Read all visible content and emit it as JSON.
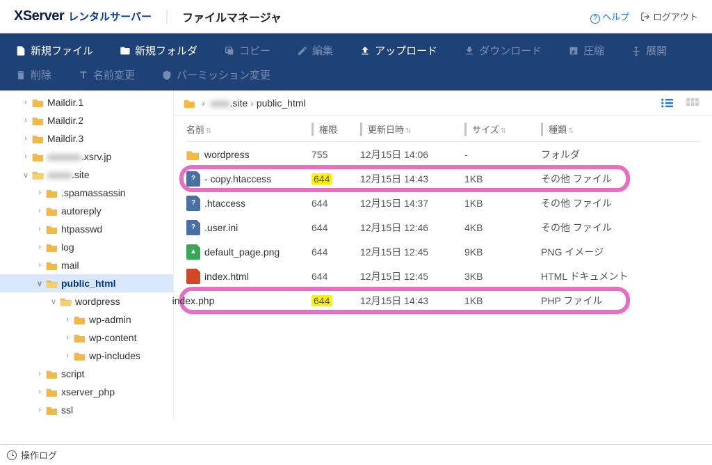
{
  "header": {
    "logo_main": "XServer",
    "logo_sub": "レンタルサーバー",
    "app_name": "ファイルマネージャ",
    "help": "ヘルプ",
    "logout": "ログアウト"
  },
  "toolbar": {
    "row1": [
      {
        "id": "new-file",
        "label": "新規ファイル",
        "enabled": true
      },
      {
        "id": "new-folder",
        "label": "新規フォルダ",
        "enabled": true
      },
      {
        "id": "copy",
        "label": "コピー",
        "enabled": false
      },
      {
        "id": "edit",
        "label": "編集",
        "enabled": false
      },
      {
        "id": "upload",
        "label": "アップロード",
        "enabled": true
      },
      {
        "id": "download",
        "label": "ダウンロード",
        "enabled": false
      },
      {
        "id": "compress",
        "label": "圧縮",
        "enabled": false
      }
    ],
    "row2": [
      {
        "id": "extract",
        "label": "展開",
        "enabled": false
      },
      {
        "id": "delete",
        "label": "削除",
        "enabled": false
      },
      {
        "id": "rename",
        "label": "名前変更",
        "enabled": false
      },
      {
        "id": "permission",
        "label": "パーミッション変更",
        "enabled": false
      }
    ]
  },
  "tree": [
    {
      "label": "Maildir.1",
      "depth": 1,
      "expanded": false,
      "open": false
    },
    {
      "label": "Maildir.2",
      "depth": 1,
      "expanded": false,
      "open": false
    },
    {
      "label": "Maildir.3",
      "depth": 1,
      "expanded": false,
      "open": false
    },
    {
      "label": ".xsrv.jp",
      "depth": 1,
      "expanded": false,
      "open": false,
      "blur": true,
      "blurred_prefix": "xxxxxxx"
    },
    {
      "label": ".site",
      "depth": 1,
      "expanded": true,
      "open": true,
      "blur": true,
      "blurred_prefix": "xxxxx"
    },
    {
      "label": ".spamassassin",
      "depth": 2,
      "expanded": false,
      "open": false
    },
    {
      "label": "autoreply",
      "depth": 2,
      "expanded": false,
      "open": false
    },
    {
      "label": "htpasswd",
      "depth": 2,
      "expanded": false,
      "open": false
    },
    {
      "label": "log",
      "depth": 2,
      "expanded": false,
      "open": false
    },
    {
      "label": "mail",
      "depth": 2,
      "expanded": false,
      "open": false
    },
    {
      "label": "public_html",
      "depth": 2,
      "expanded": true,
      "open": true,
      "active": true
    },
    {
      "label": "wordpress",
      "depth": 3,
      "expanded": true,
      "open": true
    },
    {
      "label": "wp-admin",
      "depth": 4,
      "expanded": false,
      "open": false
    },
    {
      "label": "wp-content",
      "depth": 4,
      "expanded": false,
      "open": false
    },
    {
      "label": "wp-includes",
      "depth": 4,
      "expanded": false,
      "open": false
    },
    {
      "label": "script",
      "depth": 2,
      "expanded": false,
      "open": false
    },
    {
      "label": "xserver_php",
      "depth": 2,
      "expanded": false,
      "open": false
    },
    {
      "label": "ssl",
      "depth": 2,
      "expanded": false,
      "open": false
    }
  ],
  "breadcrumb": {
    "segments": [
      {
        "label": "xxxxx.site",
        "blur": true
      },
      {
        "label": "public_html",
        "blur": false
      }
    ]
  },
  "columns": {
    "name": "名前",
    "perm": "権限",
    "date": "更新日時",
    "size": "サイズ",
    "type": "種類"
  },
  "files": [
    {
      "icon": "folder",
      "name": "wordpress",
      "perm": "755",
      "date": "12月15日 14:06",
      "size": "-",
      "type": "フォルダ",
      "highlight": false
    },
    {
      "icon": "unknown",
      "name": "- copy.htaccess",
      "perm": "644",
      "date": "12月15日 14:43",
      "size": "1KB",
      "type": "その他 ファイル",
      "highlight": true
    },
    {
      "icon": "unknown",
      "name": ".htaccess",
      "perm": "644",
      "date": "12月15日 14:37",
      "size": "1KB",
      "type": "その他 ファイル",
      "highlight": false
    },
    {
      "icon": "unknown",
      "name": ".user.ini",
      "perm": "644",
      "date": "12月15日 12:46",
      "size": "4KB",
      "type": "その他 ファイル",
      "highlight": false
    },
    {
      "icon": "image",
      "name": "default_page.png",
      "perm": "644",
      "date": "12月15日 12:45",
      "size": "9KB",
      "type": "PNG イメージ",
      "highlight": false
    },
    {
      "icon": "html",
      "name": "index.html",
      "perm": "644",
      "date": "12月15日 12:45",
      "size": "3KB",
      "type": "HTML ドキュメント",
      "highlight": false
    },
    {
      "icon": "php",
      "name": "index.php",
      "perm": "644",
      "date": "12月15日 14:43",
      "size": "1KB",
      "type": "PHP ファイル",
      "highlight": true
    }
  ],
  "bottom": {
    "log": "操作ログ"
  },
  "icon_colors": {
    "folder": "#f4b942",
    "unknown": "#4a6fa5",
    "image": "#3aa757",
    "html": "#d24726",
    "php": "#6c5bb3"
  }
}
